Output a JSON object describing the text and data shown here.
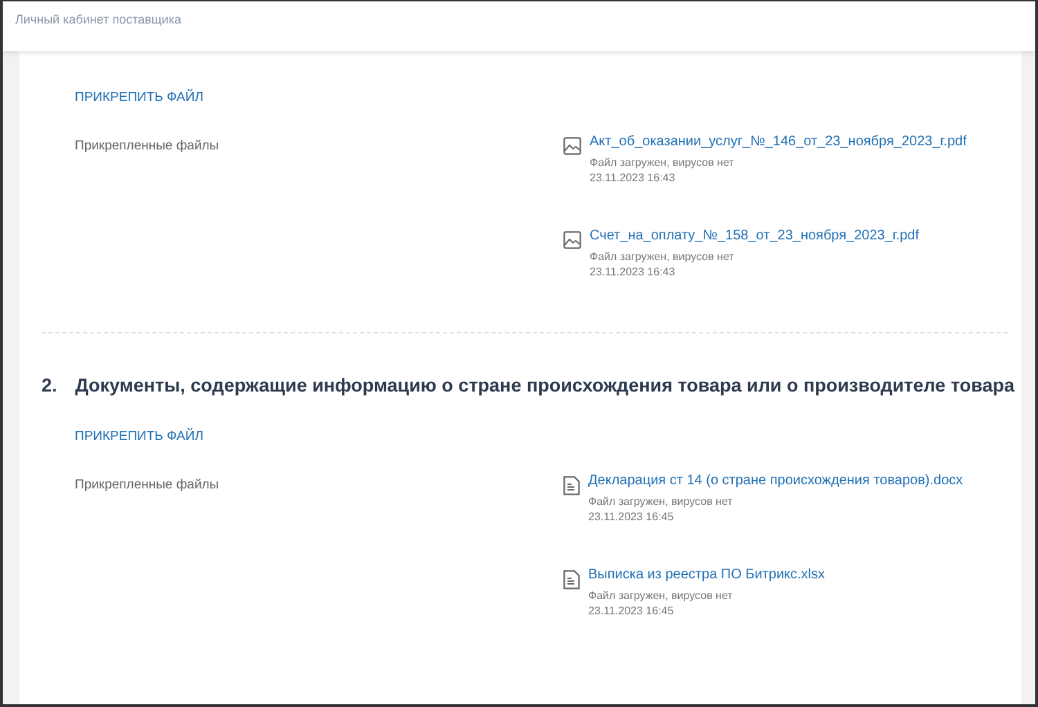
{
  "header": {
    "title": "Личный кабинет поставщика"
  },
  "sections": [
    {
      "attach_button": "ПРИКРЕПИТЬ ФАЙЛ",
      "files_label": "Прикрепленные файлы",
      "files": [
        {
          "kind": "image",
          "name": "Акт_об_оказании_услуг_№_146_от_23_ноября_2023_г.pdf",
          "status": "Файл загружен, вирусов нет",
          "date": "23.11.2023 16:43"
        },
        {
          "kind": "image",
          "name": "Счет_на_оплату_№_158_от_23_ноября_2023_г.pdf",
          "status": "Файл загружен, вирусов нет",
          "date": "23.11.2023 16:43"
        }
      ]
    },
    {
      "number": "2.",
      "heading": "Документы, содержащие информацию о стране происхождения товара или о производителе товара",
      "attach_button": "ПРИКРЕПИТЬ ФАЙЛ",
      "files_label": "Прикрепленные файлы",
      "files": [
        {
          "kind": "document",
          "name": "Декларация ст 14 (о стране происхождения товаров).docx",
          "status": "Файл загружен, вирусов нет",
          "date": "23.11.2023 16:45"
        },
        {
          "kind": "document",
          "name": "Выписка из реестра ПО Битрикс.xlsx",
          "status": "Файл загружен, вирусов нет",
          "date": "23.11.2023 16:45"
        }
      ]
    }
  ]
}
